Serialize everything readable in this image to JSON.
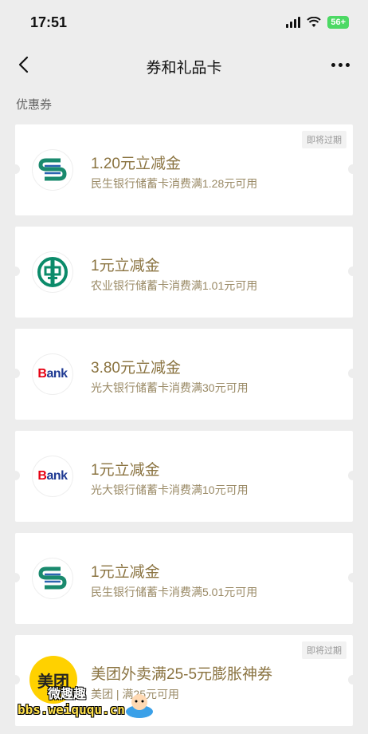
{
  "status_bar": {
    "time": "17:51",
    "battery": "56+"
  },
  "nav": {
    "title": "券和礼品卡"
  },
  "section": {
    "label": "优惠券"
  },
  "coupons": [
    {
      "title": "1.20元立减金",
      "desc": "民生银行储蓄卡消费满1.28元可用",
      "logo": "cmbc-logo",
      "badge": "即将过期"
    },
    {
      "title": "1元立减金",
      "desc": "农业银行储蓄卡消费满1.01元可用",
      "logo": "abc-logo",
      "badge": ""
    },
    {
      "title": "3.80元立减金",
      "desc": "光大银行储蓄卡消费满30元可用",
      "logo": "ebank-logo",
      "badge": ""
    },
    {
      "title": "1元立减金",
      "desc": "光大银行储蓄卡消费满10元可用",
      "logo": "ebank-logo",
      "badge": ""
    },
    {
      "title": "1元立减金",
      "desc": "民生银行储蓄卡消费满5.01元可用",
      "logo": "cmbc-logo",
      "badge": ""
    },
    {
      "title": "美团外卖满25-5元膨胀神券",
      "desc": "美团 | 满25元可用",
      "logo": "meituan-logo",
      "badge": "即将过期"
    }
  ],
  "logos": {
    "bank_word": "Bank",
    "meituan_word": "美团"
  },
  "watermark": {
    "top": "微趣趣",
    "url": "bbs.weiququ.cn"
  },
  "colors": {
    "coupon_text": "#8a7340",
    "background": "#ededed",
    "cmbc": "#1a8a6e",
    "abc": "#0b8b6a",
    "ebank_red": "#e60012",
    "ebank_blue": "#1f3a93",
    "meituan": "#ffd100"
  }
}
